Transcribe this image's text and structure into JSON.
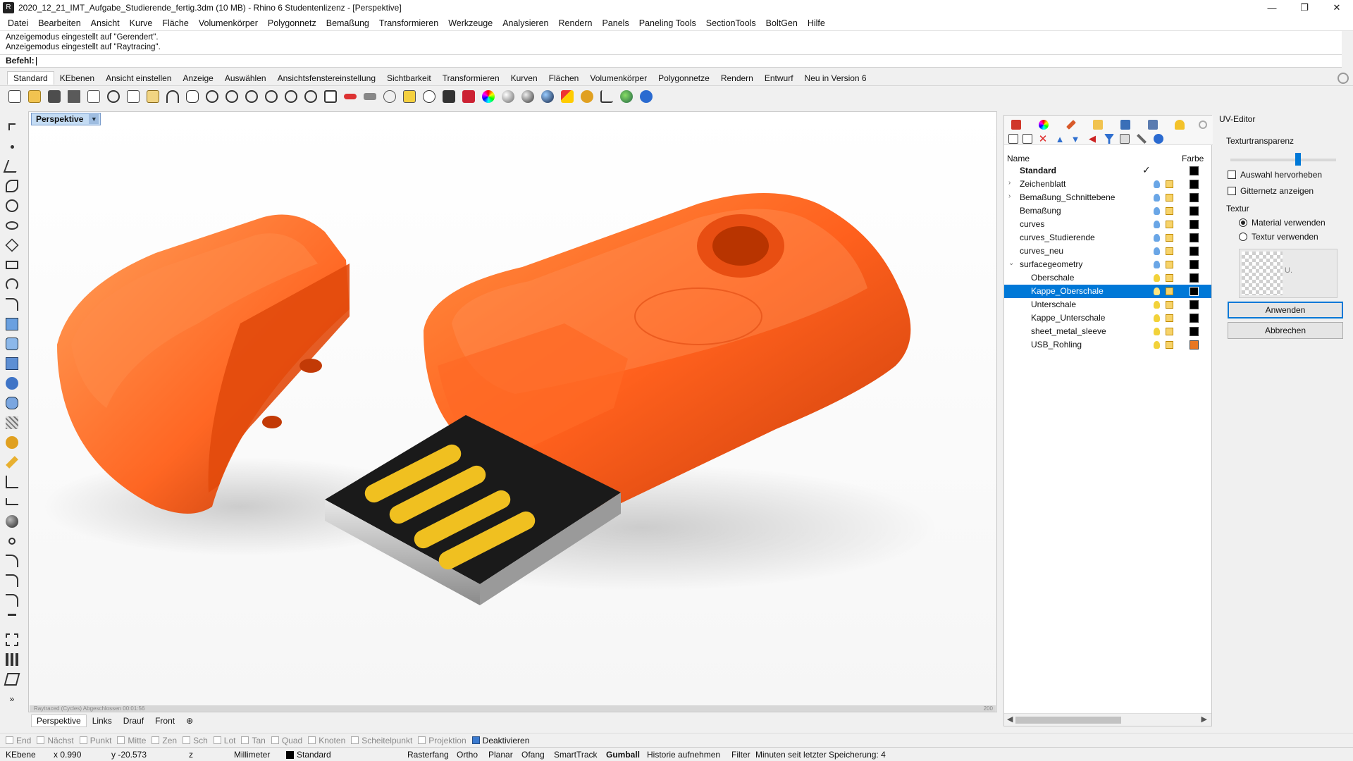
{
  "window": {
    "title": "2020_12_21_IMT_Aufgabe_Studierende_fertig.3dm (10 MB) - Rhino 6 Studentenlizenz - [Perspektive]",
    "app_icon_label": "R"
  },
  "menu": [
    "Datei",
    "Bearbeiten",
    "Ansicht",
    "Kurve",
    "Fläche",
    "Volumenkörper",
    "Polygonnetz",
    "Bemaßung",
    "Transformieren",
    "Werkzeuge",
    "Analysieren",
    "Rendern",
    "Panels",
    "Paneling Tools",
    "SectionTools",
    "BoltGen",
    "Hilfe"
  ],
  "command": {
    "history": [
      "Anzeigemodus eingestellt auf \"Gerendert\".",
      "Anzeigemodus eingestellt auf \"Raytracing\"."
    ],
    "prompt": "Befehl:"
  },
  "tool_tabs": [
    "Standard",
    "KEbenen",
    "Ansicht einstellen",
    "Anzeige",
    "Auswählen",
    "Ansichtsfenstereinstellung",
    "Sichtbarkeit",
    "Transformieren",
    "Kurven",
    "Flächen",
    "Volumenkörper",
    "Polygonnetze",
    "Rendern",
    "Entwurf",
    "Neu in Version 6"
  ],
  "viewport": {
    "name": "Perspektive",
    "status_left": "Raytraced (Cycles)   Abgeschlossen   00:01:56",
    "status_right": "200",
    "tabs": [
      "Perspektive",
      "Links",
      "Drauf",
      "Front"
    ],
    "add_tab": "⊕"
  },
  "layers": {
    "header_name": "Name",
    "header_color": "Farbe",
    "rows": [
      {
        "name": "Standard",
        "indent": 0,
        "current": true,
        "bold": true,
        "color": "#000000"
      },
      {
        "name": "Zeichenblatt",
        "indent": 0,
        "expander": "›",
        "color": "#000000"
      },
      {
        "name": "Bemaßung_Schnittebene",
        "indent": 0,
        "expander": "›",
        "color": "#000000"
      },
      {
        "name": "Bemaßung",
        "indent": 0,
        "color": "#000000"
      },
      {
        "name": "curves",
        "indent": 0,
        "color": "#000000"
      },
      {
        "name": "curves_Studierende",
        "indent": 0,
        "color": "#000000"
      },
      {
        "name": "curves_neu",
        "indent": 0,
        "color": "#000000"
      },
      {
        "name": "surfacegeometry",
        "indent": 0,
        "expander": "⌄",
        "color": "#000000"
      },
      {
        "name": "Oberschale",
        "indent": 1,
        "color": "#000000"
      },
      {
        "name": "Kappe_Oberschale",
        "indent": 1,
        "selected": true,
        "color": "#000000"
      },
      {
        "name": "Unterschale",
        "indent": 1,
        "color": "#000000"
      },
      {
        "name": "Kappe_Unterschale",
        "indent": 1,
        "color": "#000000"
      },
      {
        "name": "sheet_metal_sleeve",
        "indent": 1,
        "color": "#000000"
      },
      {
        "name": "USB_Rohling",
        "indent": 1,
        "color": "#e87722"
      }
    ]
  },
  "uv_editor": {
    "title": "UV-Editor",
    "transparency_label": "Texturtransparenz",
    "highlight_label": "Auswahl hervorheben",
    "mesh_label": "Gitternetz anzeigen",
    "texture_label": "Textur",
    "radio_material": "Material verwenden",
    "radio_texture": "Textur verwenden",
    "texture_placeholder": "U.",
    "apply": "Anwenden",
    "cancel": "Abbrechen"
  },
  "osnaps": [
    {
      "label": "End",
      "on": false
    },
    {
      "label": "Nächst",
      "on": false
    },
    {
      "label": "Punkt",
      "on": false
    },
    {
      "label": "Mitte",
      "on": false
    },
    {
      "label": "Zen",
      "on": false
    },
    {
      "label": "Sch",
      "on": false
    },
    {
      "label": "Lot",
      "on": false
    },
    {
      "label": "Tan",
      "on": false
    },
    {
      "label": "Quad",
      "on": false
    },
    {
      "label": "Knoten",
      "on": false
    },
    {
      "label": "Scheitelpunkt",
      "on": false
    },
    {
      "label": "Projektion",
      "on": false
    },
    {
      "label": "Deaktivieren",
      "on": true
    }
  ],
  "status": {
    "cplane": "KEbene",
    "x": "x 0.990",
    "y": "y -20.573",
    "z": "z",
    "units": "Millimeter",
    "layer": "Standard",
    "grid_snap": "Rasterfang",
    "ortho": "Ortho",
    "planar": "Planar",
    "osnap": "Ofang",
    "smarttrack": "SmartTrack",
    "gumball": "Gumball",
    "history": "Historie aufnehmen",
    "filter": "Filter",
    "save_info": "Minuten seit letzter Speicherung: 4"
  },
  "colors": {
    "accent": "#0078d7",
    "usb_orange": "#ff5a14",
    "contacts": "#f0c020"
  }
}
